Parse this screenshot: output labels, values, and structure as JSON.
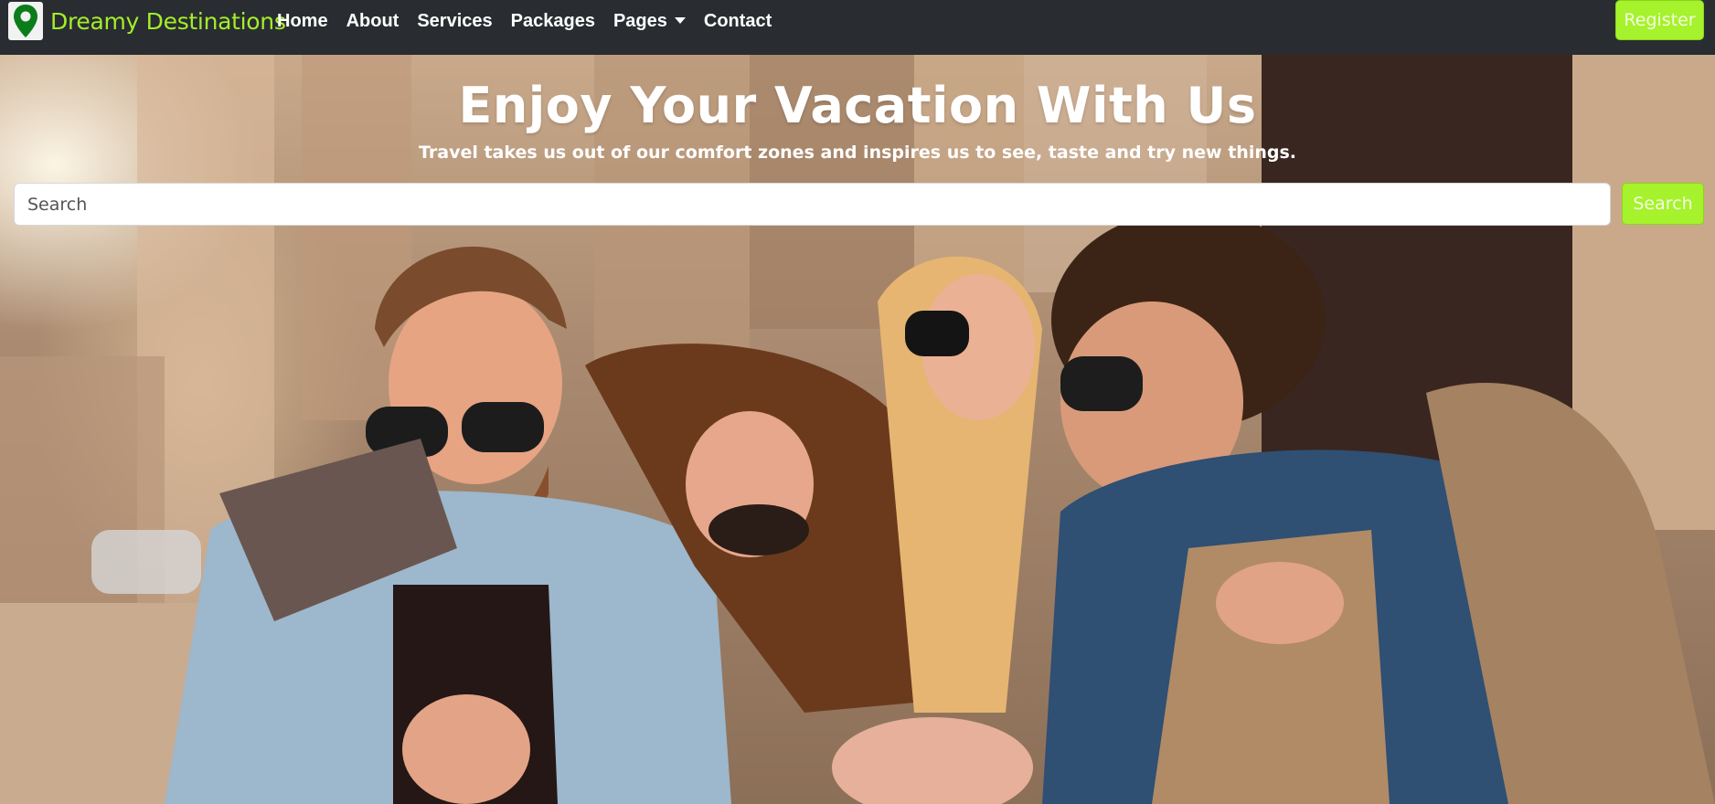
{
  "brand": {
    "name": "Dreamy Destinations",
    "logo_icon": "map-pin-icon"
  },
  "nav": {
    "items": [
      {
        "label": "Home"
      },
      {
        "label": "About"
      },
      {
        "label": "Services"
      },
      {
        "label": "Packages"
      },
      {
        "label": "Pages",
        "dropdown": true
      },
      {
        "label": "Contact"
      }
    ],
    "register_label": "Register"
  },
  "hero": {
    "title": "Enjoy Your Vacation With Us",
    "subtitle": "Travel takes us out of our comfort zones and inspires us to see, taste and try new things.",
    "search_placeholder": "Search",
    "search_button": "Search"
  },
  "colors": {
    "accent": "#a6f22c",
    "navbar": "#292d31",
    "brand_text": "#a4ee2a",
    "logo_pin": "#0a7d1a"
  }
}
